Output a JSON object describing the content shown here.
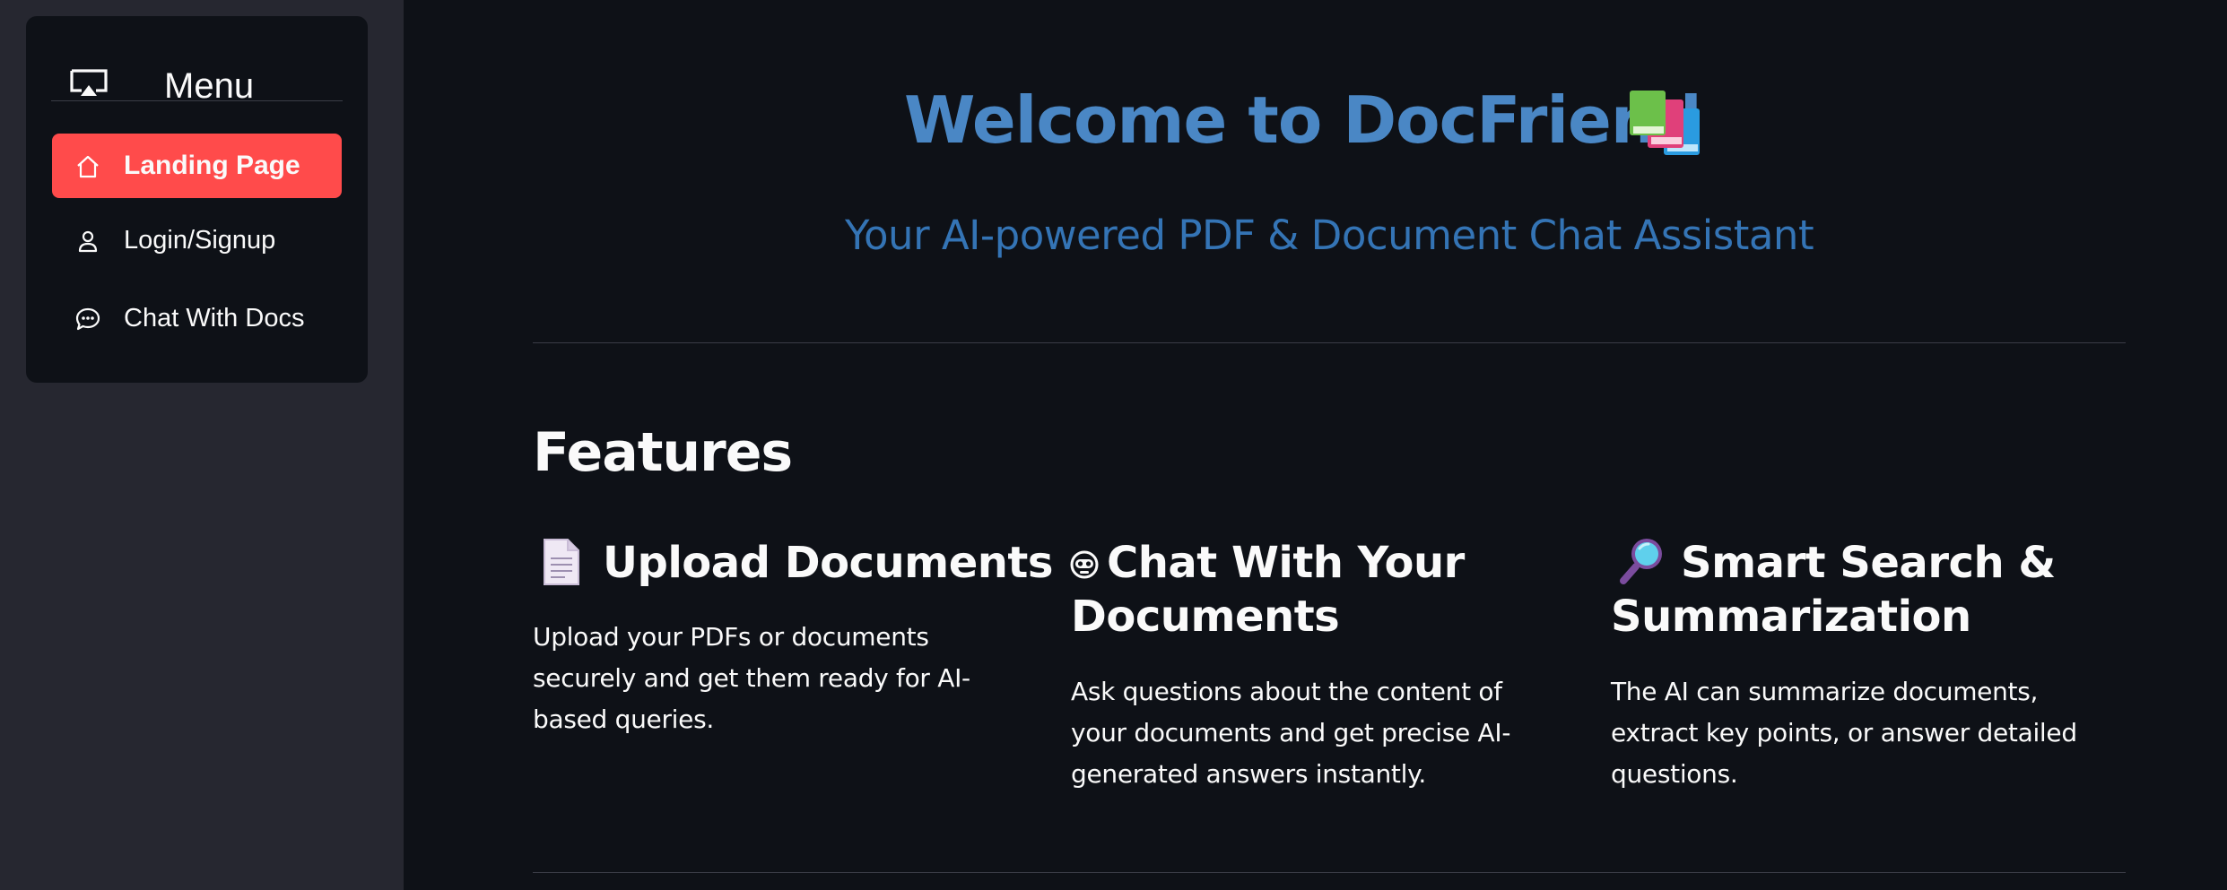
{
  "sidebar": {
    "menu_title": "Menu",
    "items": [
      {
        "label": "Landing Page",
        "icon": "house-icon",
        "active": true
      },
      {
        "label": "Login/Signup",
        "icon": "person-icon",
        "active": false
      },
      {
        "label": "Chat With Docs",
        "icon": "chat-bubble-icon",
        "active": false
      }
    ],
    "active_color": "#ff4b4b"
  },
  "hero": {
    "title": "Welcome to DocFriend",
    "title_icon": "books-icon",
    "subtitle": "Your AI-powered PDF & Document Chat Assistant",
    "title_color": "#4a87c5"
  },
  "features": {
    "heading": "Features",
    "items": [
      {
        "icon": "document-icon",
        "title_line1": "Upload Documents",
        "title_line2": "",
        "description": "Upload your PDFs or documents securely and get them ready for AI-based queries."
      },
      {
        "icon": "robot-icon",
        "title_line1": "Chat With Your",
        "title_line2": "Documents",
        "description": "Ask questions about the content of your documents and get precise AI-generated answers instantly."
      },
      {
        "icon": "magnifying-glass-icon",
        "title_line1": "Smart Search &",
        "title_line2": "Summarization",
        "description": "The AI can summarize documents, extract key points, or answer detailed questions."
      }
    ]
  }
}
